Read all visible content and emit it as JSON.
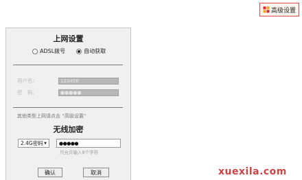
{
  "advanced_button": {
    "label": "高级设置",
    "icon": "gear-grid-icon"
  },
  "panel": {
    "title": "上网设置",
    "connection_options": [
      {
        "label": "ADSL拨号",
        "selected": false
      },
      {
        "label": "自动获取",
        "selected": true
      }
    ],
    "username": {
      "label": "用户名:",
      "value": "123456"
    },
    "password": {
      "label": "密　码:",
      "value": "●●●●●"
    },
    "hint": "其他类型上网请点击 “高级设置”"
  },
  "wireless": {
    "title": "无线加密",
    "security_select": {
      "value": "2.4G密码"
    },
    "password_value": "●●●●●",
    "password_hint": "只允许输入8个字符"
  },
  "buttons": {
    "confirm": "确认",
    "cancel": "取消"
  },
  "watermark": "xuexila.com",
  "colors": {
    "accent_border": "#e04848",
    "watermark": "#cc4444",
    "disabled_input": "#b8b8b8"
  }
}
